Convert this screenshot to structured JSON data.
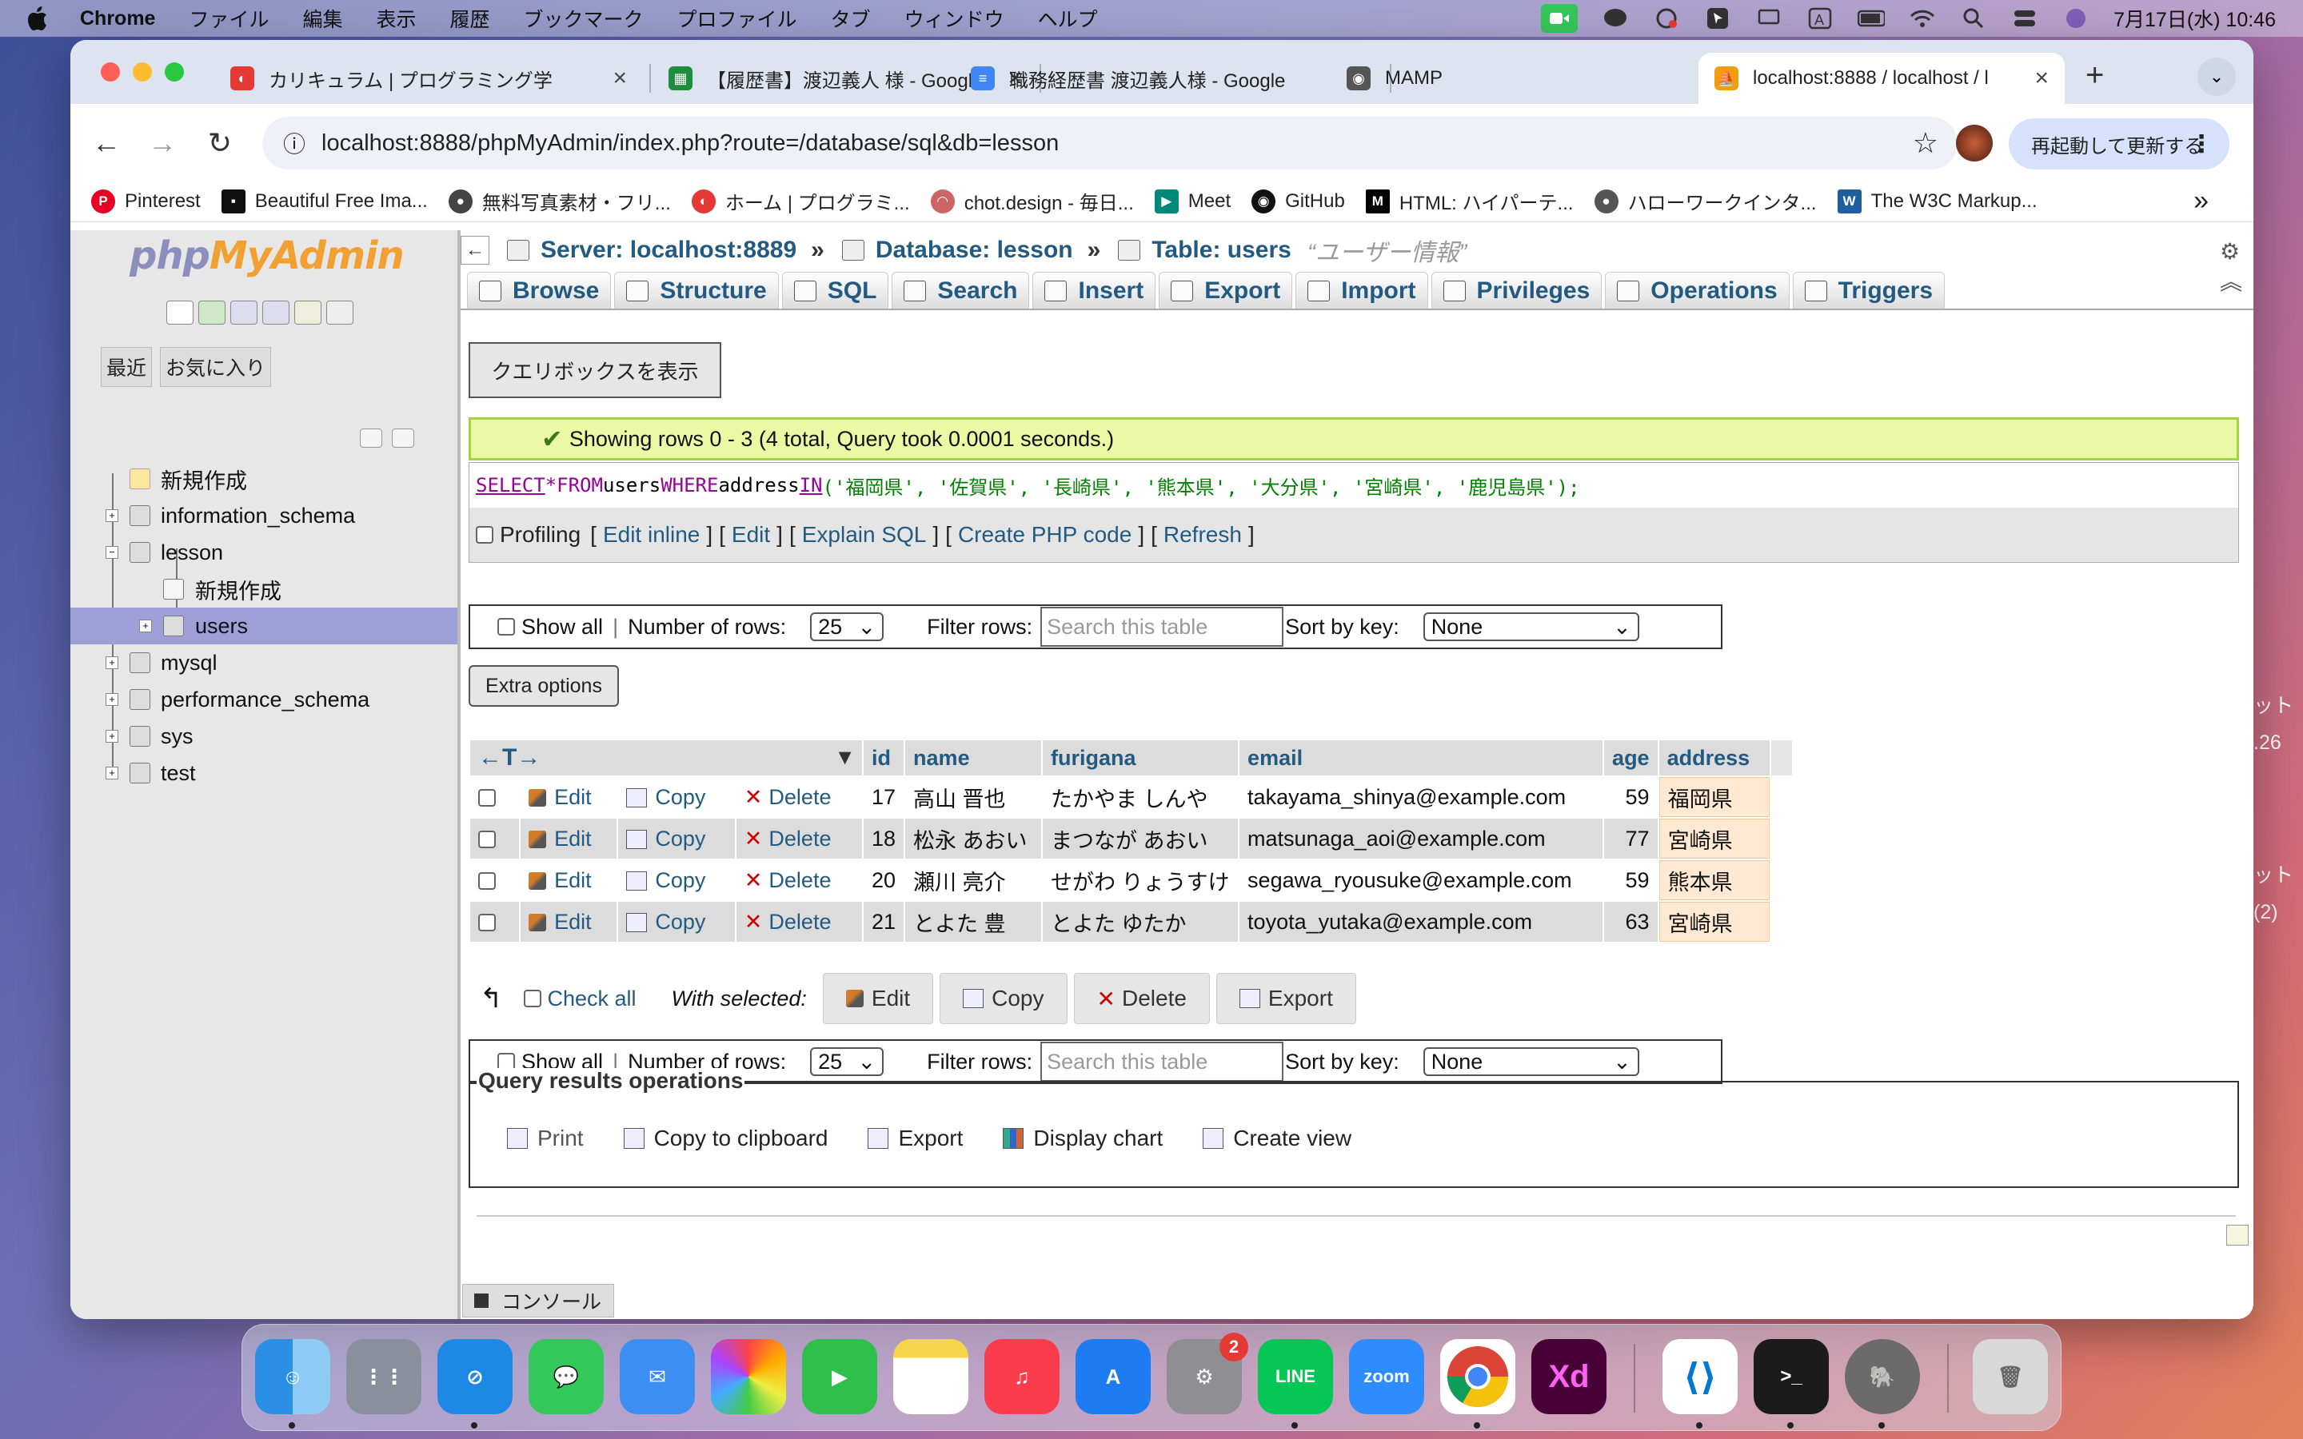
{
  "menubar": {
    "app": "Chrome",
    "items": [
      "ファイル",
      "編集",
      "表示",
      "履歴",
      "ブックマーク",
      "プロファイル",
      "タブ",
      "ウィンドウ",
      "ヘルプ"
    ],
    "datetime": "7月17日(水) 10:46"
  },
  "browser": {
    "tabs": [
      {
        "title": "カリキュラム | プログラミング学",
        "color": "#e53935"
      },
      {
        "title": "【履歴書】渡辺義人 様 - Google",
        "color": "#1e8e3e"
      },
      {
        "title": "職務経歴書 渡辺義人様 - Google",
        "color": "#4285f4"
      },
      {
        "title": "MAMP",
        "color": "#555555"
      },
      {
        "title": "localhost:8888 / localhost / l",
        "color": "#f39c12"
      }
    ],
    "url": "localhost:8888/phpMyAdmin/index.php?route=/database/sql&db=lesson",
    "relaunch_label": "再起動して更新する",
    "bookmarks": [
      {
        "label": "Pinterest",
        "color": "#e60023",
        "glyph": "P"
      },
      {
        "label": "Beautiful Free Ima...",
        "color": "#111111",
        "glyph": "▪"
      },
      {
        "label": "無料写真素材・フリ...",
        "color": "#444444",
        "glyph": "●"
      },
      {
        "label": "ホーム | プログラミ...",
        "color": "#e53935",
        "glyph": "◐"
      },
      {
        "label": "chot.design - 毎日...",
        "color": "#cc6666",
        "glyph": "◠"
      },
      {
        "label": "Meet",
        "color": "#00897b",
        "glyph": "▶"
      },
      {
        "label": "GitHub",
        "color": "#111111",
        "glyph": "◉"
      },
      {
        "label": "HTML: ハイパーテ...",
        "color": "#000000",
        "glyph": "M"
      },
      {
        "label": "ハローワークインタ...",
        "color": "#555555",
        "glyph": "●"
      },
      {
        "label": "The W3C Markup...",
        "color": "#1f5fa0",
        "glyph": "W"
      }
    ]
  },
  "sidebar": {
    "logo_a": "php",
    "logo_b": "MyAdmin",
    "tab_recent": "最近",
    "tab_fav": "お気に入り",
    "tree": [
      {
        "label": "新規作成",
        "level": 0,
        "expand": ""
      },
      {
        "label": "information_schema",
        "level": 0,
        "expand": "+"
      },
      {
        "label": "lesson",
        "level": 0,
        "expand": "−"
      },
      {
        "label": "新規作成",
        "level": 1,
        "expand": ""
      },
      {
        "label": "users",
        "level": 1,
        "expand": "+",
        "selected": true
      },
      {
        "label": "mysql",
        "level": 0,
        "expand": "+"
      },
      {
        "label": "performance_schema",
        "level": 0,
        "expand": "+"
      },
      {
        "label": "sys",
        "level": 0,
        "expand": "+"
      },
      {
        "label": "test",
        "level": 0,
        "expand": "+"
      }
    ],
    "console": "コンソール"
  },
  "breadcrumb": {
    "server": "Server: localhost:8889",
    "database": "Database: lesson",
    "table": "Table: users",
    "comment": "“ユーザー情報”"
  },
  "tabs": [
    "Browse",
    "Structure",
    "SQL",
    "Search",
    "Insert",
    "Export",
    "Import",
    "Privileges",
    "Operations",
    "Triggers"
  ],
  "query_box_button": "クエリボックスを表示",
  "success_message": "Showing rows 0 - 3 (4 total, Query took 0.0001 seconds.)",
  "sql": {
    "select": "SELECT",
    "star": " * ",
    "from": "FROM",
    "table": " users ",
    "where": "WHERE",
    "col": " address ",
    "in": "IN",
    "values": "('福岡県', '佐賀県', '長崎県', '熊本県', '大分県', '宮崎県', '鹿児島県');"
  },
  "sql_ops": {
    "profiling": "Profiling",
    "links": [
      "Edit inline",
      "Edit",
      "Explain SQL",
      "Create PHP code",
      "Refresh"
    ]
  },
  "nav": {
    "show_all": "Show all",
    "rows_label": "Number of rows:",
    "rows_value": "25",
    "filter_label": "Filter rows:",
    "filter_placeholder": "Search this table",
    "sort_label": "Sort by key:",
    "sort_value": "None"
  },
  "extra_options": "Extra options",
  "table": {
    "columns": [
      "id",
      "name",
      "furigana",
      "email",
      "age",
      "address"
    ],
    "action_labels": {
      "edit": "Edit",
      "copy": "Copy",
      "delete": "Delete"
    },
    "rows": [
      [
        "17",
        "高山 晋也",
        "たかやま しんや",
        "takayama_shinya@example.com",
        "59",
        "福岡県"
      ],
      [
        "18",
        "松永 あおい",
        "まつなが あおい",
        "matsunaga_aoi@example.com",
        "77",
        "宮崎県"
      ],
      [
        "20",
        "瀬川 亮介",
        "せがわ りょうすけ",
        "segawa_ryousuke@example.com",
        "59",
        "熊本県"
      ],
      [
        "21",
        "とよた 豊",
        "とよた ゆたか",
        "toyota_yutaka@example.com",
        "63",
        "宮崎県"
      ]
    ]
  },
  "bulk": {
    "check_all": "Check all",
    "with_selected": "With selected:",
    "buttons": [
      "Edit",
      "Copy",
      "Delete",
      "Export"
    ]
  },
  "qro": {
    "title": "Query results operations",
    "ops": [
      "Print",
      "Copy to clipboard",
      "Export",
      "Display chart",
      "Create view"
    ]
  },
  "dock": [
    {
      "name": "finder",
      "color": "#3b8ee8"
    },
    {
      "name": "launchpad",
      "color": "#8a8f9c"
    },
    {
      "name": "safari",
      "color": "#1e88e5"
    },
    {
      "name": "messages",
      "color": "#34c759"
    },
    {
      "name": "mail",
      "color": "#3d8ef0"
    },
    {
      "name": "photos",
      "color": "#f2f2f2"
    },
    {
      "name": "facetime",
      "color": "#2fbf4a"
    },
    {
      "name": "notes",
      "color": "#f7d54a"
    },
    {
      "name": "music",
      "color": "#fa3c4c"
    },
    {
      "name": "app-store",
      "color": "#1e7cf2"
    },
    {
      "name": "system-settings",
      "color": "#8e8e93",
      "badge": "2"
    },
    {
      "name": "line",
      "color": "#06c755",
      "label": "LINE"
    },
    {
      "name": "zoom",
      "color": "#2d8cff",
      "label": "zoom"
    },
    {
      "name": "chrome",
      "color": "#ffffff"
    },
    {
      "name": "adobe-xd",
      "color": "#470137",
      "label": "Xd"
    },
    {
      "name": "vscode",
      "color": "#ffffff"
    },
    {
      "name": "terminal",
      "color": "#1b1b1b",
      "label": ">_"
    },
    {
      "name": "tableplus",
      "color": "#6b6b6b"
    },
    {
      "name": "trash",
      "color": "#d8d8d8"
    }
  ],
  "desktop_side": {
    "line1": "ット",
    "line2": ".26",
    "line3": "ット",
    "line4": "(2)"
  }
}
